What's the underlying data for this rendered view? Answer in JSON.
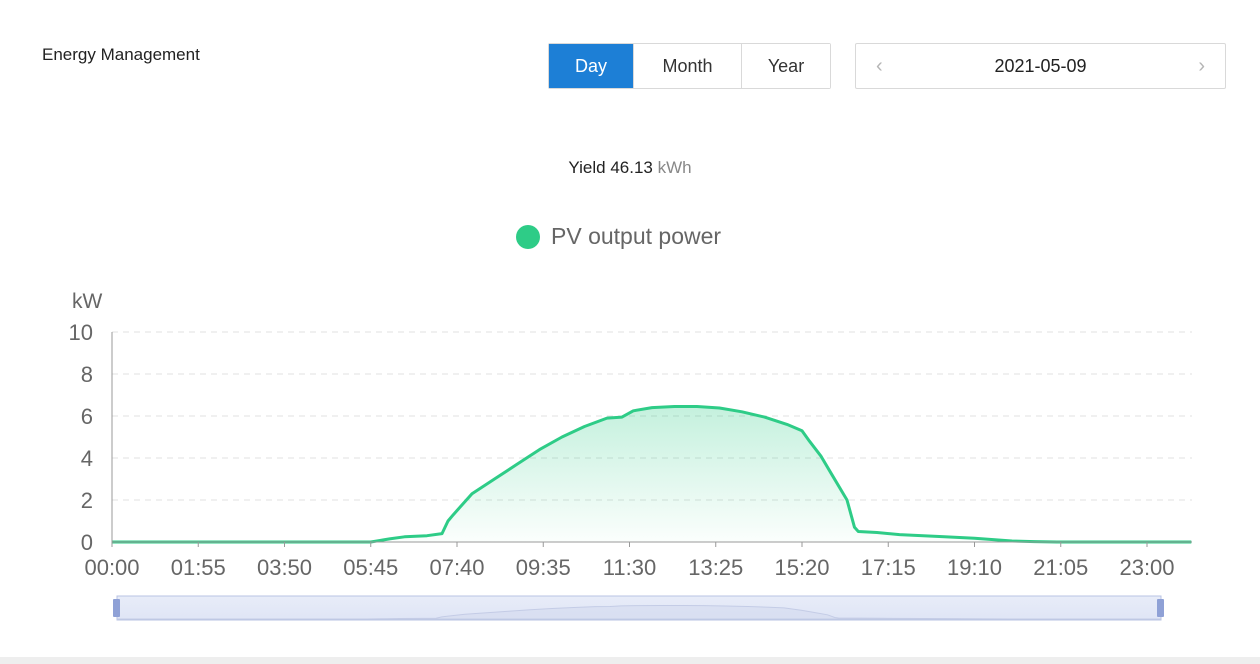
{
  "page": {
    "title": "Energy Management"
  },
  "period": {
    "options": [
      "Day",
      "Month",
      "Year"
    ],
    "selected": "Day"
  },
  "date_picker": {
    "value": "2021-05-09",
    "prev_icon": "chevron-left-icon",
    "next_icon": "chevron-right-icon"
  },
  "summary": {
    "label": "Yield",
    "value": "46.13",
    "unit": "kWh"
  },
  "colors": {
    "accent": "#1d7fd6",
    "series": "#2ecc87",
    "grid": "#e0e0e0",
    "axis_text": "#666666"
  },
  "chart_data": {
    "type": "area",
    "title": "",
    "legend": {
      "entries": [
        "PV output power"
      ],
      "placement": "top-center"
    },
    "ylabel": "kW",
    "xlabel": "",
    "ylim": [
      0,
      10
    ],
    "y_ticks": [
      0,
      2,
      4,
      6,
      8,
      10
    ],
    "x_tick_labels": [
      "00:00",
      "01:55",
      "03:50",
      "05:45",
      "07:40",
      "09:35",
      "11:30",
      "13:25",
      "15:20",
      "17:15",
      "19:10",
      "21:05",
      "23:00"
    ],
    "grid": true,
    "series": [
      {
        "name": "PV output power",
        "x": [
          "00:00",
          "05:45",
          "06:10",
          "06:30",
          "07:00",
          "07:20",
          "07:28",
          "07:35",
          "08:00",
          "08:30",
          "09:00",
          "09:30",
          "10:00",
          "10:30",
          "11:00",
          "11:20",
          "11:35",
          "12:00",
          "12:30",
          "13:00",
          "13:30",
          "14:00",
          "14:30",
          "15:00",
          "15:20",
          "15:30",
          "15:45",
          "16:00",
          "16:20",
          "16:30",
          "16:35",
          "17:00",
          "17:30",
          "18:30",
          "19:10",
          "20:00",
          "20:30",
          "21:00",
          "23:59"
        ],
        "values": [
          0.0,
          0.0,
          0.15,
          0.25,
          0.3,
          0.4,
          1.0,
          1.3,
          2.3,
          3.0,
          3.7,
          4.4,
          5.0,
          5.5,
          5.9,
          5.95,
          6.25,
          6.4,
          6.45,
          6.45,
          6.38,
          6.2,
          5.95,
          5.6,
          5.3,
          4.8,
          4.1,
          3.2,
          2.0,
          0.7,
          0.5,
          0.45,
          0.35,
          0.25,
          0.18,
          0.05,
          0.02,
          0.0,
          0.0
        ]
      }
    ],
    "zoom_slider": {
      "start_fraction": 0.0,
      "end_fraction": 1.0
    }
  }
}
